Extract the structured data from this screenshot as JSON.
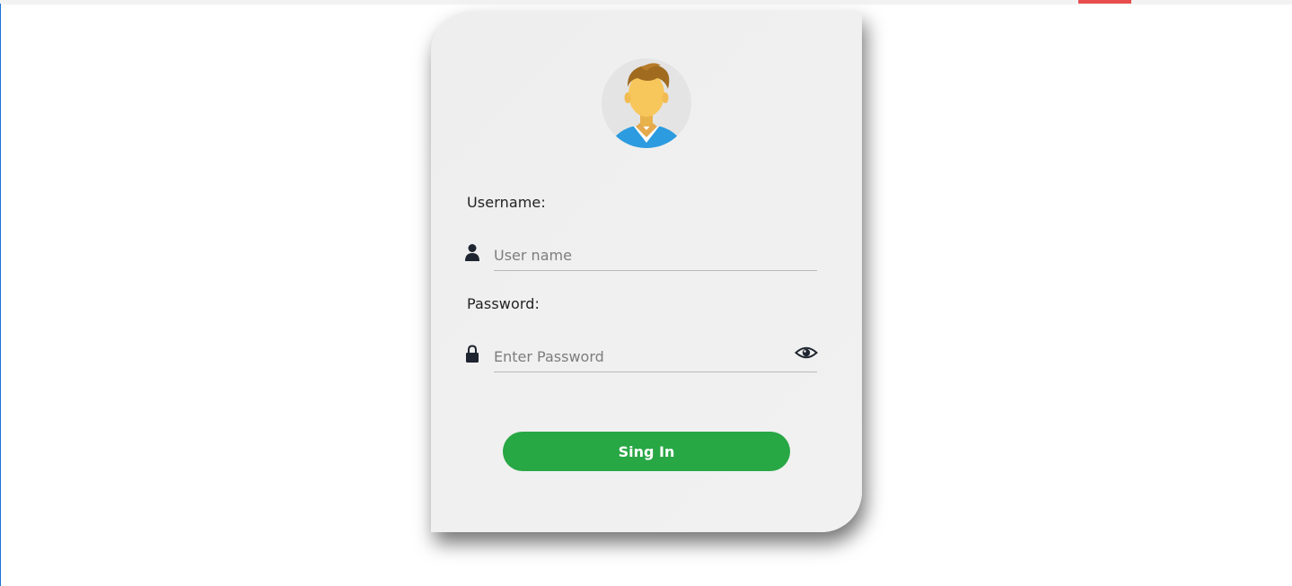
{
  "form": {
    "username_label": "Username:",
    "username_placeholder": "User name",
    "password_label": "Password:",
    "password_placeholder": "Enter Password",
    "submit_label": "Sing In"
  },
  "icons": {
    "avatar": "user-avatar",
    "username": "user-icon",
    "password": "lock-icon",
    "toggle": "eye-icon"
  },
  "colors": {
    "button": "#28a745",
    "card": "#f0f0f0",
    "top_accent": "#e84c4c",
    "left_edge": "#1e73d8"
  }
}
